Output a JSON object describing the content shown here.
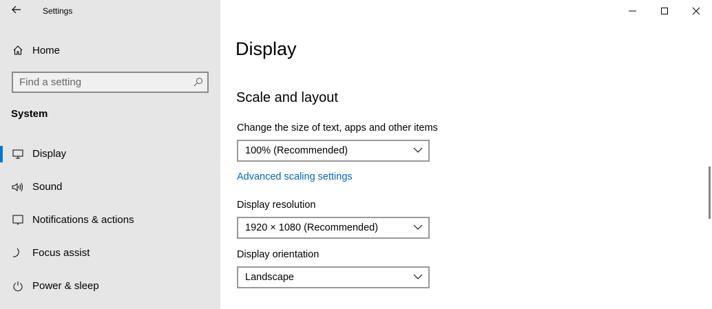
{
  "window": {
    "title": "Settings",
    "back": "back-arrow-icon",
    "controls": [
      "minimize",
      "maximize",
      "close"
    ]
  },
  "sidebar": {
    "home": "Home",
    "search_placeholder": "Find a setting",
    "section": "System",
    "items": [
      {
        "label": "Display",
        "icon": "monitor-icon",
        "selected": true
      },
      {
        "label": "Sound",
        "icon": "speaker-icon"
      },
      {
        "label": "Notifications & actions",
        "icon": "notification-icon"
      },
      {
        "label": "Focus assist",
        "icon": "moon-icon"
      },
      {
        "label": "Power & sleep",
        "icon": "power-icon"
      }
    ]
  },
  "main": {
    "title": "Display",
    "section": "Scale and layout",
    "scale_label": "Change the size of text, apps and other items",
    "scale_value": "100% (Recommended)",
    "advanced_link": "Advanced scaling settings",
    "resolution_label": "Display resolution",
    "resolution_value": "1920 × 1080 (Recommended)",
    "orientation_label": "Display orientation",
    "orientation_value": "Landscape"
  },
  "colors": {
    "accent": "#0078d7",
    "link": "#0067c0",
    "sidebar_bg": "#e6e6e6"
  }
}
